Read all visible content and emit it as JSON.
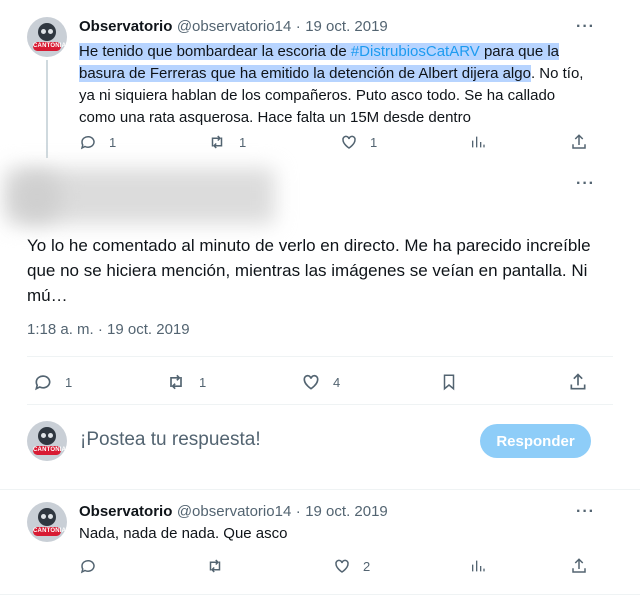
{
  "tweet1": {
    "name": "Observatorio",
    "handle": "@observatorio14",
    "dot": "·",
    "date": "19 oct. 2019",
    "avatar_badge": "CANTONIA",
    "text_a": "He tenido que bombardear la escoria de ",
    "hashtag": "#DistrubiosCatARV",
    "text_b": " para que la",
    "text_c": "basura de Ferreras que ha emitido la detención de Albert dijera algo",
    "text_d": ". No tío, ya ni siquiera hablan de los compañeros. Puto asco todo. Se ha callado como una rata asquerosa. Hace falta un 15M desde dentro",
    "replies": "1",
    "retweets": "1",
    "likes": "1"
  },
  "main_tweet": {
    "text": "Yo lo he comentado al minuto de verlo en directo. Me ha parecido increíble que no se hiciera mención, mientras las imágenes se veían en pantalla. Ni mú…",
    "timestamp": "1:18 a. m. · 19 oct. 2019",
    "replies": "1",
    "retweets": "1",
    "likes": "4"
  },
  "compose": {
    "placeholder": "¡Postea tu respuesta!",
    "button": "Responder"
  },
  "tweet2": {
    "name": "Observatorio",
    "handle": "@observatorio14",
    "dot": "·",
    "date": "19 oct. 2019",
    "text": "Nada, nada de nada. Que asco",
    "likes": "2"
  },
  "more_label": "···",
  "colors": {
    "accent": "#1d9bf0",
    "button_disabled": "#8ecdf8",
    "highlight": "#b7d4ff"
  }
}
